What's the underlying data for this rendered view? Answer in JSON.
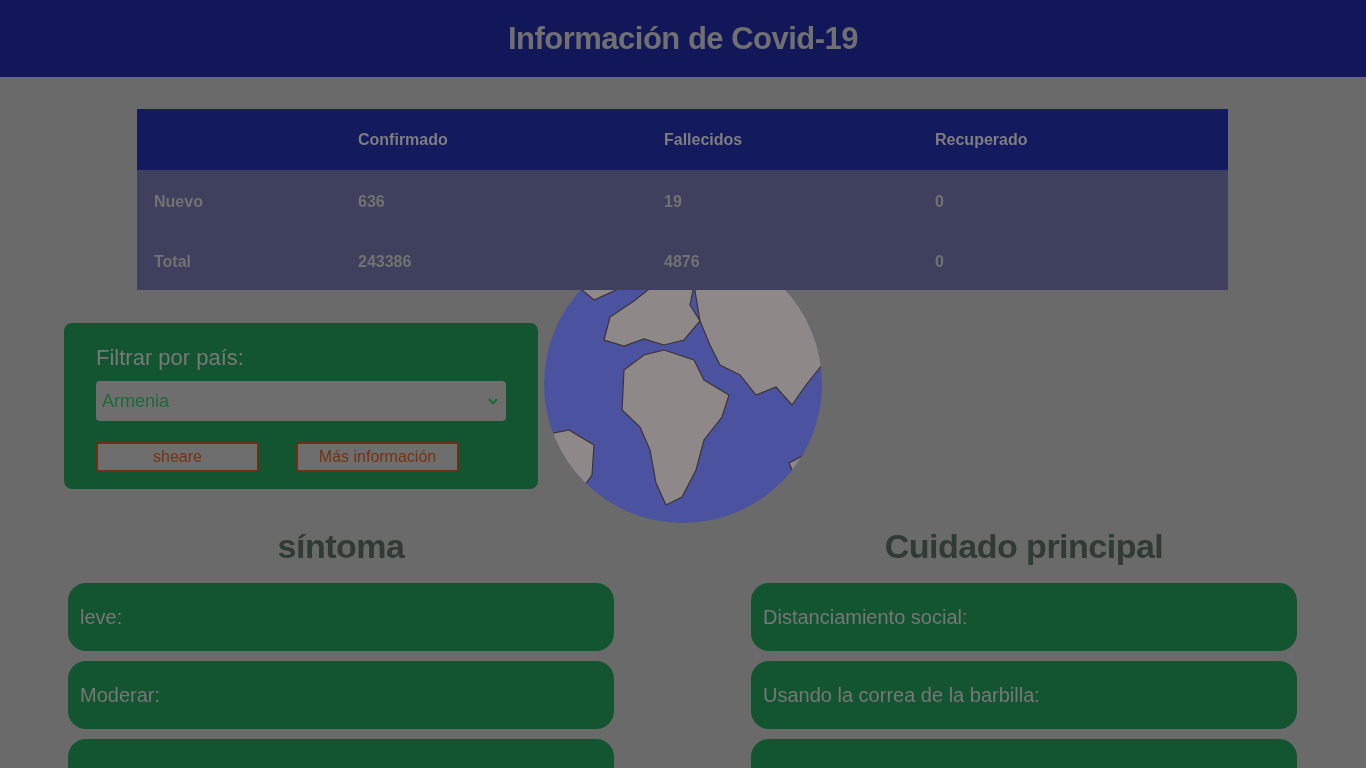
{
  "header": {
    "title": "Información de Covid-19"
  },
  "stats_table": {
    "columns": [
      {
        "label": "Confirmado"
      },
      {
        "label": "Fallecidos"
      },
      {
        "label": "Recuperado"
      }
    ],
    "rows": [
      {
        "label": "Nuevo",
        "cells": [
          "636",
          "19",
          "0"
        ]
      },
      {
        "label": "Total",
        "cells": [
          "243386",
          "4876",
          "0"
        ]
      }
    ]
  },
  "filter": {
    "label": "Filtrar por país:",
    "country_select": {
      "value": "Armenia"
    },
    "buttons": [
      "sheare",
      "Más información"
    ]
  },
  "sections": [
    {
      "heading": "síntoma",
      "cards": [
        {
          "kind": "text",
          "label": "leve:"
        },
        {
          "kind": "text",
          "label": "Moderar:"
        },
        {
          "kind": "cut"
        }
      ]
    },
    {
      "heading": "Cuidado principal",
      "cards": [
        {
          "kind": "text",
          "label": "Distanciamiento social:"
        },
        {
          "kind": "text",
          "label": "Usando la correa de la barbilla:"
        },
        {
          "kind": "cut"
        }
      ]
    }
  ]
}
